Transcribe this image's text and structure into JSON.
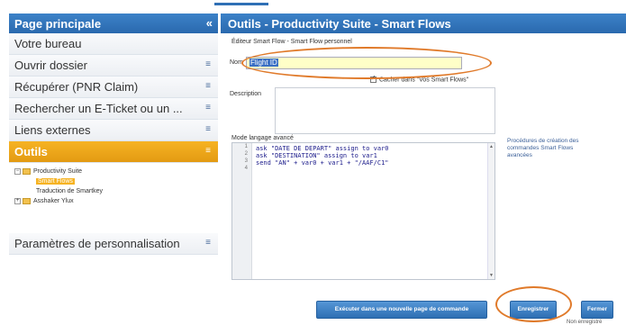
{
  "sidebar": {
    "title": "Page principale",
    "collapse_icon": "«",
    "items": [
      {
        "label": "Votre bureau",
        "chevron": ""
      },
      {
        "label": "Ouvrir dossier",
        "chevron": "≡"
      },
      {
        "label": "Récupérer (PNR Claim)",
        "chevron": "≡"
      },
      {
        "label": "Rechercher un E-Ticket ou un ...",
        "chevron": "≡"
      },
      {
        "label": "Liens externes",
        "chevron": "≡"
      }
    ],
    "active": {
      "label": "Outils",
      "chevron": "≡"
    },
    "tree": [
      {
        "toggle": "−",
        "label": "Productivity Suite"
      },
      {
        "label": "Smart Flows"
      },
      {
        "label": "Traduction de Smartkey"
      },
      {
        "toggle": "+",
        "label": "Asshaker Ylux"
      }
    ],
    "bottom": {
      "label": "Paramètres de personnalisation",
      "chevron": "≡"
    }
  },
  "main": {
    "title": "Outils - Productivity Suite - Smart Flows",
    "breadcrumb": "Éditeur Smart Flow - Smart Flow personnel",
    "name_label": "Nom",
    "name_value": "Flight ID",
    "checkbox_label": "Cacher dans \"Vos Smart Flows\"",
    "description_label": "Description",
    "code_label": "Mode langage avancé",
    "code_lines": [
      "ask \"DATE DE DEPART\" assign to var0",
      "ask \"DESTINATION\" assign to var1",
      "send \"AN\" + var0 + var1 + \"/AAF/C1\""
    ],
    "line_numbers": [
      "1",
      "2",
      "3",
      "4"
    ],
    "help_text": "Procédures de création des commandes Smart Flows avancées",
    "btn_new_page": "Exécuter dans une nouvelle page de commande",
    "btn_save": "Enregistrer",
    "btn_close": "Fermer",
    "footnote": "Non enregistré"
  }
}
